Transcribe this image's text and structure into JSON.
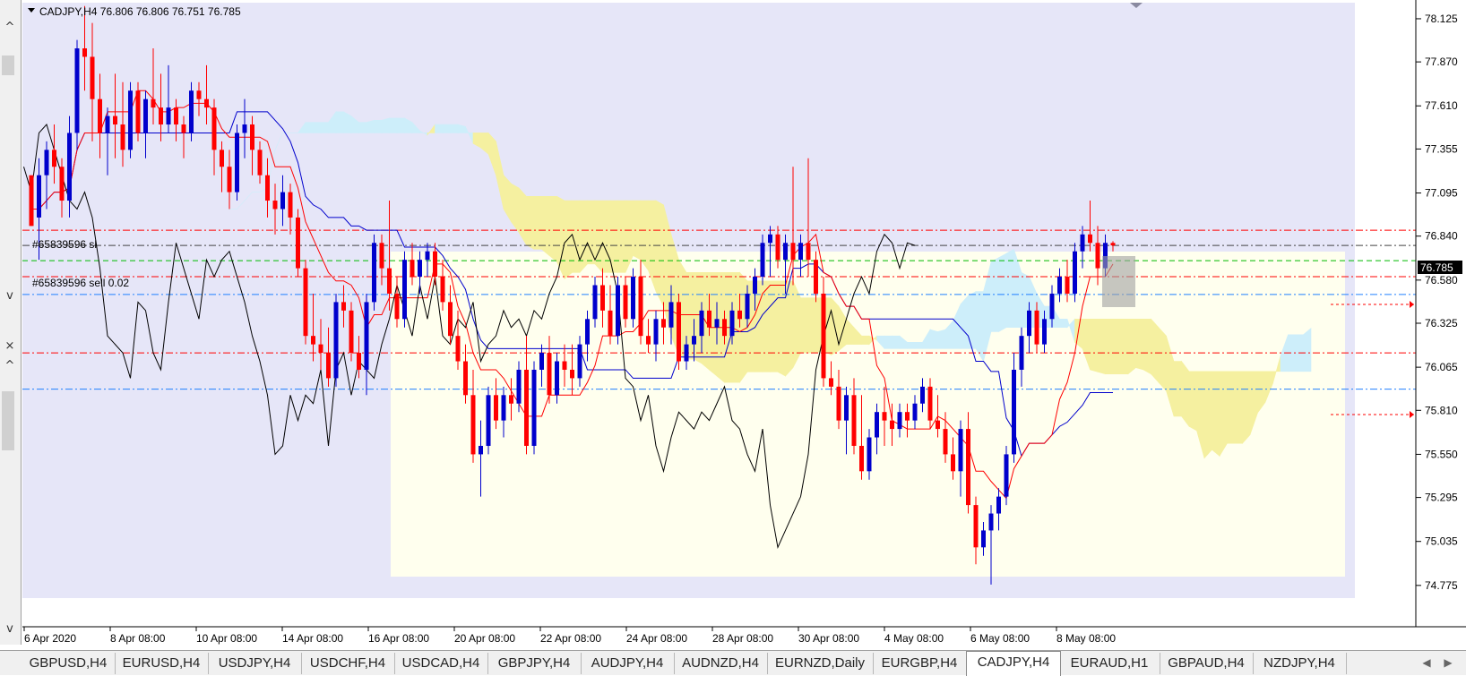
{
  "window": {
    "symbol_info": "CADJPY,H4  76.806 76.806 76.751 76.785"
  },
  "price_axis": {
    "ticks": [
      "78.125",
      "77.870",
      "77.610",
      "77.355",
      "77.095",
      "76.840",
      "76.580",
      "76.325",
      "76.065",
      "75.810",
      "75.550",
      "75.295",
      "75.035",
      "74.775"
    ],
    "current_price": "76.785"
  },
  "time_axis": {
    "labels": [
      "6 Apr 2020",
      "8 Apr 08:00",
      "10 Apr 08:00",
      "14 Apr 08:00",
      "16 Apr 08:00",
      "20 Apr 08:00",
      "22 Apr 08:00",
      "24 Apr 08:00",
      "28 Apr 08:00",
      "30 Apr 08:00",
      "4 May 08:00",
      "6 May 08:00",
      "8 May 08:00"
    ]
  },
  "orders": {
    "sl_label": "#65839596 sl",
    "sell_label": "#65839596 sell 0.02"
  },
  "tabs": [
    {
      "label": "GBPUSD,H4",
      "active": false
    },
    {
      "label": "EURUSD,H4",
      "active": false
    },
    {
      "label": "USDJPY,H4",
      "active": false
    },
    {
      "label": "USDCHF,H4",
      "active": false
    },
    {
      "label": "USDCAD,H4",
      "active": false
    },
    {
      "label": "GBPJPY,H4",
      "active": false
    },
    {
      "label": "AUDJPY,H4",
      "active": false
    },
    {
      "label": "AUDNZD,H4",
      "active": false
    },
    {
      "label": "EURNZD,Daily",
      "active": false
    },
    {
      "label": "EURGBP,H4",
      "active": false
    },
    {
      "label": "CADJPY,H4",
      "active": true
    },
    {
      "label": "EURAUD,H1",
      "active": false
    },
    {
      "label": "GBPAUD,H4",
      "active": false
    },
    {
      "label": "NZDJPY,H4",
      "active": false
    }
  ],
  "side": {
    "collapse_top": "^",
    "collapse_bottom": "v",
    "close": "×",
    "scroll_up": "^",
    "scroll_down": "v"
  },
  "colors": {
    "bull": "#0000cc",
    "bear": "#ff0000",
    "background": "#e6e6f8",
    "rect_fill": "#ffffee",
    "kumo_bull": "#cdeefa",
    "kumo_bear": "#f5f0a0"
  },
  "chart_data": {
    "type": "candlestick",
    "symbol": "CADJPY",
    "timeframe": "H4",
    "ylim": [
      74.7,
      78.22
    ],
    "current_price": 76.785,
    "x_labels": [
      "6 Apr 2020",
      "8 Apr 08:00",
      "10 Apr 08:00",
      "14 Apr 08:00",
      "16 Apr 08:00",
      "20 Apr 08:00",
      "22 Apr 08:00",
      "24 Apr 08:00",
      "28 Apr 08:00",
      "30 Apr 08:00",
      "4 May 08:00",
      "6 May 08:00",
      "8 May 08:00"
    ],
    "candles": [
      [
        77.2,
        77.1,
        76.9,
        76.9
      ],
      [
        76.95,
        77.3,
        76.7,
        77.2
      ],
      [
        77.2,
        77.4,
        77.0,
        77.35
      ],
      [
        77.35,
        77.5,
        77.15,
        77.25
      ],
      [
        77.25,
        77.3,
        76.95,
        77.05
      ],
      [
        77.05,
        77.55,
        76.95,
        77.45
      ],
      [
        77.45,
        78.0,
        77.35,
        77.95
      ],
      [
        77.95,
        78.2,
        77.7,
        77.9
      ],
      [
        77.9,
        78.1,
        77.4,
        77.65
      ],
      [
        77.65,
        77.8,
        77.3,
        77.45
      ],
      [
        77.45,
        77.6,
        77.2,
        77.55
      ],
      [
        77.55,
        77.8,
        77.3,
        77.5
      ],
      [
        77.5,
        77.75,
        77.25,
        77.35
      ],
      [
        77.35,
        77.75,
        77.3,
        77.7
      ],
      [
        77.7,
        77.75,
        77.4,
        77.45
      ],
      [
        77.45,
        77.7,
        77.3,
        77.65
      ],
      [
        77.65,
        77.95,
        77.5,
        77.6
      ],
      [
        77.6,
        77.8,
        77.4,
        77.5
      ],
      [
        77.5,
        77.85,
        77.45,
        77.6
      ],
      [
        77.6,
        77.65,
        77.4,
        77.5
      ],
      [
        77.5,
        77.55,
        77.3,
        77.45
      ],
      [
        77.45,
        77.75,
        77.4,
        77.7
      ],
      [
        77.7,
        77.75,
        77.55,
        77.65
      ],
      [
        77.65,
        77.85,
        77.5,
        77.6
      ],
      [
        77.6,
        77.65,
        77.2,
        77.35
      ],
      [
        77.35,
        77.4,
        77.1,
        77.25
      ],
      [
        77.25,
        77.35,
        77.0,
        77.1
      ],
      [
        77.1,
        77.5,
        77.05,
        77.45
      ],
      [
        77.45,
        77.65,
        77.3,
        77.5
      ],
      [
        77.5,
        77.55,
        77.2,
        77.35
      ],
      [
        77.35,
        77.4,
        77.15,
        77.2
      ],
      [
        77.2,
        77.3,
        76.95,
        77.05
      ],
      [
        77.05,
        77.15,
        76.85,
        77.0
      ],
      [
        77.0,
        77.2,
        76.9,
        77.1
      ],
      [
        77.1,
        77.15,
        76.85,
        76.95
      ],
      [
        76.95,
        77.0,
        76.6,
        76.65
      ],
      [
        76.65,
        76.7,
        76.2,
        76.25
      ],
      [
        76.25,
        76.5,
        76.1,
        76.2
      ],
      [
        76.2,
        76.35,
        76.05,
        76.15
      ],
      [
        76.15,
        76.3,
        75.95,
        76.0
      ],
      [
        76.0,
        76.5,
        75.95,
        76.45
      ],
      [
        76.45,
        76.55,
        76.3,
        76.4
      ],
      [
        76.4,
        76.45,
        76.1,
        76.15
      ],
      [
        76.15,
        76.25,
        76.0,
        76.05
      ],
      [
        76.05,
        76.5,
        75.9,
        76.45
      ],
      [
        76.45,
        76.85,
        76.4,
        76.8
      ],
      [
        76.8,
        76.85,
        76.55,
        76.65
      ],
      [
        76.65,
        77.05,
        76.4,
        76.5
      ],
      [
        76.5,
        76.6,
        76.3,
        76.35
      ],
      [
        76.35,
        76.75,
        76.3,
        76.7
      ],
      [
        76.7,
        76.8,
        76.55,
        76.6
      ],
      [
        76.6,
        76.75,
        76.5,
        76.7
      ],
      [
        76.7,
        76.8,
        76.6,
        76.75
      ],
      [
        76.75,
        76.8,
        76.55,
        76.6
      ],
      [
        76.6,
        76.7,
        76.4,
        76.45
      ],
      [
        76.45,
        76.55,
        76.2,
        76.25
      ],
      [
        76.25,
        76.4,
        76.05,
        76.1
      ],
      [
        76.1,
        76.2,
        75.85,
        75.9
      ],
      [
        75.9,
        76.05,
        75.5,
        75.55
      ],
      [
        75.55,
        75.75,
        75.3,
        75.6
      ],
      [
        75.6,
        75.95,
        75.55,
        75.9
      ],
      [
        75.9,
        76.0,
        75.7,
        75.75
      ],
      [
        75.75,
        75.95,
        75.65,
        75.9
      ],
      [
        75.9,
        76.0,
        75.75,
        75.85
      ],
      [
        75.85,
        76.1,
        75.8,
        76.05
      ],
      [
        76.05,
        76.25,
        75.55,
        75.6
      ],
      [
        75.6,
        76.1,
        75.55,
        76.05
      ],
      [
        76.05,
        76.2,
        75.95,
        76.15
      ],
      [
        76.15,
        76.25,
        75.85,
        75.9
      ],
      [
        75.9,
        76.15,
        75.85,
        76.1
      ],
      [
        76.1,
        76.2,
        75.95,
        76.05
      ],
      [
        76.05,
        76.2,
        75.9,
        76.0
      ],
      [
        76.0,
        76.25,
        75.95,
        76.2
      ],
      [
        76.2,
        76.4,
        76.1,
        76.35
      ],
      [
        76.35,
        76.6,
        76.3,
        76.55
      ],
      [
        76.55,
        76.65,
        76.3,
        76.4
      ],
      [
        76.4,
        76.55,
        76.2,
        76.25
      ],
      [
        76.25,
        76.6,
        76.2,
        76.55
      ],
      [
        76.55,
        76.6,
        76.3,
        76.35
      ],
      [
        76.35,
        76.65,
        76.3,
        76.6
      ],
      [
        76.6,
        76.7,
        76.2,
        76.25
      ],
      [
        76.25,
        76.35,
        76.15,
        76.2
      ],
      [
        76.2,
        76.4,
        76.1,
        76.35
      ],
      [
        76.35,
        76.45,
        76.2,
        76.3
      ],
      [
        76.3,
        76.55,
        76.2,
        76.45
      ],
      [
        76.45,
        76.5,
        76.05,
        76.1
      ],
      [
        76.1,
        76.25,
        76.05,
        76.2
      ],
      [
        76.2,
        76.35,
        76.1,
        76.25
      ],
      [
        76.25,
        76.45,
        76.15,
        76.4
      ],
      [
        76.4,
        76.5,
        76.25,
        76.3
      ],
      [
        76.3,
        76.45,
        76.2,
        76.35
      ],
      [
        76.35,
        76.4,
        76.2,
        76.25
      ],
      [
        76.25,
        76.45,
        76.2,
        76.4
      ],
      [
        76.4,
        76.5,
        76.3,
        76.35
      ],
      [
        76.35,
        76.55,
        76.3,
        76.5
      ],
      [
        76.5,
        76.65,
        76.4,
        76.6
      ],
      [
        76.6,
        76.85,
        76.55,
        76.8
      ],
      [
        76.8,
        76.9,
        76.6,
        76.85
      ],
      [
        76.85,
        76.9,
        76.65,
        76.7
      ],
      [
        76.7,
        76.85,
        76.5,
        76.8
      ],
      [
        76.8,
        77.25,
        76.55,
        76.7
      ],
      [
        76.7,
        76.85,
        76.6,
        76.8
      ],
      [
        76.8,
        77.3,
        76.6,
        76.7
      ],
      [
        76.7,
        76.75,
        76.45,
        76.5
      ],
      [
        76.5,
        76.6,
        75.95,
        76.0
      ],
      [
        76.0,
        76.1,
        75.9,
        75.95
      ],
      [
        75.95,
        76.05,
        75.7,
        75.75
      ],
      [
        75.75,
        75.95,
        75.55,
        75.9
      ],
      [
        75.9,
        76.0,
        75.55,
        75.6
      ],
      [
        75.6,
        75.9,
        75.4,
        75.45
      ],
      [
        75.45,
        75.7,
        75.4,
        75.65
      ],
      [
        75.65,
        75.85,
        75.55,
        75.8
      ],
      [
        75.8,
        75.95,
        75.6,
        75.75
      ],
      [
        75.75,
        75.85,
        75.6,
        75.7
      ],
      [
        75.7,
        75.85,
        75.65,
        75.8
      ],
      [
        75.8,
        75.85,
        75.65,
        75.75
      ],
      [
        75.75,
        75.9,
        75.7,
        75.85
      ],
      [
        75.85,
        76.0,
        75.8,
        75.95
      ],
      [
        75.95,
        76.0,
        75.7,
        75.75
      ],
      [
        75.75,
        75.9,
        75.65,
        75.7
      ],
      [
        75.7,
        75.8,
        75.5,
        75.55
      ],
      [
        75.55,
        75.65,
        75.4,
        75.45
      ],
      [
        75.45,
        75.75,
        75.3,
        75.7
      ],
      [
        75.7,
        75.8,
        75.2,
        75.25
      ],
      [
        75.25,
        75.3,
        74.9,
        75.0
      ],
      [
        75.0,
        75.15,
        74.95,
        75.1
      ],
      [
        75.1,
        75.25,
        74.78,
        75.2
      ],
      [
        75.2,
        75.35,
        75.1,
        75.3
      ],
      [
        75.3,
        75.6,
        75.25,
        75.55
      ],
      [
        75.55,
        76.15,
        75.5,
        76.05
      ],
      [
        76.05,
        76.3,
        75.95,
        76.25
      ],
      [
        76.25,
        76.45,
        76.15,
        76.4
      ],
      [
        76.4,
        76.45,
        76.15,
        76.2
      ],
      [
        76.2,
        76.4,
        76.15,
        76.35
      ],
      [
        76.35,
        76.55,
        76.3,
        76.5
      ],
      [
        76.5,
        76.65,
        76.45,
        76.6
      ],
      [
        76.6,
        76.7,
        76.45,
        76.5
      ],
      [
        76.5,
        76.8,
        76.45,
        76.75
      ],
      [
        76.75,
        76.9,
        76.65,
        76.85
      ],
      [
        76.85,
        77.05,
        76.75,
        76.8
      ],
      [
        76.8,
        76.9,
        76.55,
        76.65
      ],
      [
        76.65,
        76.85,
        76.6,
        76.8
      ],
      [
        76.8,
        76.81,
        76.75,
        76.785
      ]
    ],
    "horizontal_levels": [
      {
        "price": 76.875,
        "color": "#ff0000",
        "style": "dashdot"
      },
      {
        "price": 76.785,
        "color": "#444444",
        "style": "dashdot"
      },
      {
        "price": 76.695,
        "color": "#00bb00",
        "style": "dash"
      },
      {
        "price": 76.6,
        "color": "#ff0000",
        "style": "dashdot"
      },
      {
        "price": 76.495,
        "color": "#2080ff",
        "style": "dashdot"
      },
      {
        "price": 76.15,
        "color": "#ff0000",
        "style": "dashdot"
      },
      {
        "price": 75.935,
        "color": "#2080ff",
        "style": "dashdot"
      }
    ]
  }
}
